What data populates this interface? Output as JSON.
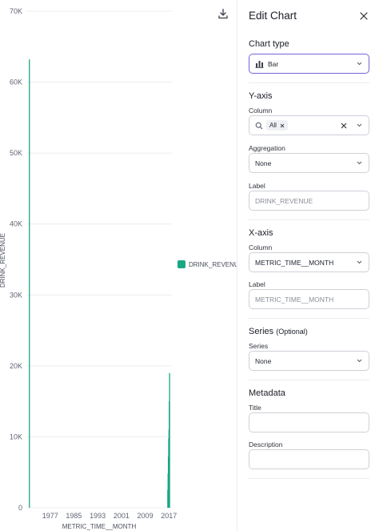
{
  "chart": {
    "legend_label": "DRINK_REVENUE",
    "download_icon": "download-icon",
    "series_color": "#1ba784"
  },
  "chart_data": {
    "type": "bar",
    "title": "",
    "xlabel": "METRIC_TIME__MONTH",
    "ylabel": "DRINK_REVENUE",
    "ylim": [
      0,
      70000
    ],
    "y_ticks": [
      "0",
      "10K",
      "20K",
      "30K",
      "40K",
      "50K",
      "60K",
      "70K"
    ],
    "x_ticks": [
      "1977",
      "1985",
      "1993",
      "2001",
      "2009",
      "2017"
    ],
    "xlim": [
      1969,
      2018
    ],
    "series": [
      {
        "name": "DRINK_REVENUE",
        "x": [
          1970,
          2016.6,
          2016.7,
          2016.8,
          2016.9,
          2017.0,
          2017.1,
          2017.2
        ],
        "values": [
          63200,
          2500,
          4800,
          7200,
          9800,
          11000,
          15000,
          19000
        ]
      }
    ],
    "grid": true,
    "legend": "right"
  },
  "panel": {
    "title": "Edit Chart",
    "chart_type": {
      "section": "Chart type",
      "value": "Bar"
    },
    "y_axis": {
      "section": "Y-axis",
      "column_label": "Column",
      "chip": "All",
      "aggregation_label": "Aggregation",
      "aggregation_value": "None",
      "label_label": "Label",
      "label_placeholder": "DRINK_REVENUE"
    },
    "x_axis": {
      "section": "X-axis",
      "column_label": "Column",
      "column_value": "METRIC_TIME__MONTH",
      "label_label": "Label",
      "label_placeholder": "METRIC_TIME__MONTH"
    },
    "series": {
      "section": "Series",
      "optional": "(Optional)",
      "series_label": "Series",
      "series_value": "None"
    },
    "metadata": {
      "section": "Metadata",
      "title_label": "Title",
      "description_label": "Description"
    },
    "accent_color": "#7b61d9"
  }
}
